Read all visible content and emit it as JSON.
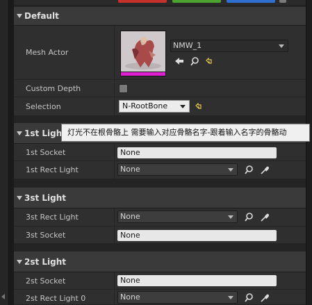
{
  "sections": {
    "default": {
      "title": "Default",
      "mesh_actor": {
        "label": "Mesh Actor",
        "value": "NMW_1"
      },
      "custom_depth": {
        "label": "Custom Depth",
        "checked": false
      },
      "selection": {
        "label": "Selection",
        "value": "N-RootBone"
      }
    },
    "light1": {
      "title": "1st Light",
      "socket": {
        "label": "1st Socket",
        "value": "None"
      },
      "rect_light": {
        "label": "1st Rect Light",
        "value": "None"
      }
    },
    "light3": {
      "title": "3st Light",
      "rect_light": {
        "label": "3st Rect Light",
        "value": "None"
      },
      "socket": {
        "label": "3st Socket",
        "value": "None"
      }
    },
    "light2": {
      "title": "2st Light",
      "socket": {
        "label": "2st Socket",
        "value": "None"
      },
      "rect_light": {
        "label": "2st Rect Light 0",
        "value": "None"
      }
    }
  },
  "tooltip": "灯光不在根骨骼上 需要输入对应骨骼名字-跟着输入名字的骨骼动",
  "colors": {
    "thumbnail_bar": "#e01fd0",
    "reset_arrow": "#e6c64a",
    "top_swatches": [
      "#c8302c",
      "#4da32f",
      "#2f6fcf"
    ]
  },
  "icons": {
    "use_selected": "arrow-left-icon",
    "browse": "magnifier-icon",
    "reset": "reset-arrow-icon",
    "picker": "eyedropper-icon"
  }
}
